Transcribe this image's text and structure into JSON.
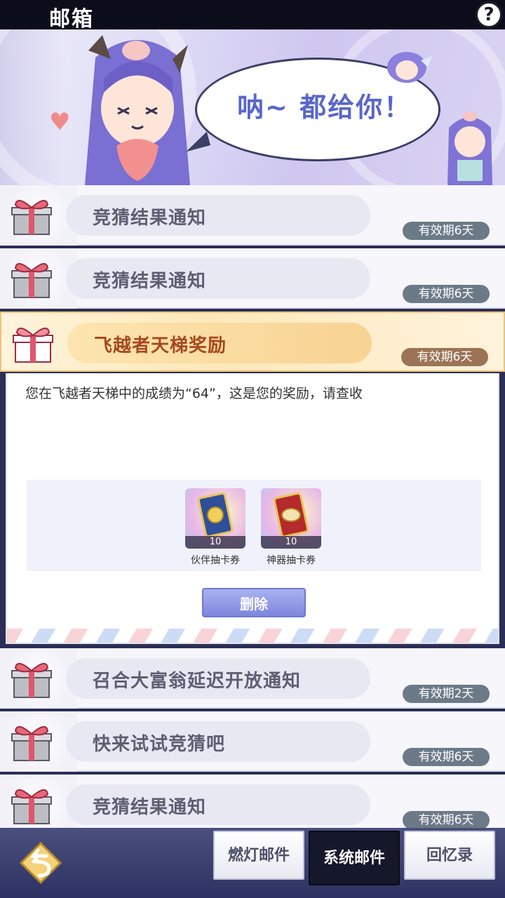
{
  "header": {
    "title": "邮箱",
    "help_label": "?"
  },
  "banner": {
    "speech": "呐~ 都给你！"
  },
  "mails": [
    {
      "subject": "竞猜结果通知",
      "expire": "有效期6天"
    },
    {
      "subject": "竞猜结果通知",
      "expire": "有效期6天"
    },
    {
      "subject": "飞越者天梯奖励",
      "expire": "有效期6天"
    },
    {
      "subject": "召合大富翁延迟开放通知",
      "expire": "有效期2天"
    },
    {
      "subject": "快来试试竞猜吧",
      "expire": "有效期6天"
    },
    {
      "subject": "竞猜结果通知",
      "expire": "有效期6天"
    }
  ],
  "opened_mail": {
    "content": "您在飞越者天梯中的成绩为“64”，这是您的奖励，请查收",
    "rewards": [
      {
        "name": "伙伴抽卡券",
        "count": "10"
      },
      {
        "name": "神器抽卡券",
        "count": "10"
      }
    ],
    "delete_label": "删除"
  },
  "tabs": [
    {
      "label": "燃灯邮件"
    },
    {
      "label": "系统邮件"
    },
    {
      "label": "回忆录"
    }
  ],
  "colors": {
    "accent": "#7e86de",
    "active_row": "#fde8b9",
    "expire_badge": "#6c7a88"
  }
}
